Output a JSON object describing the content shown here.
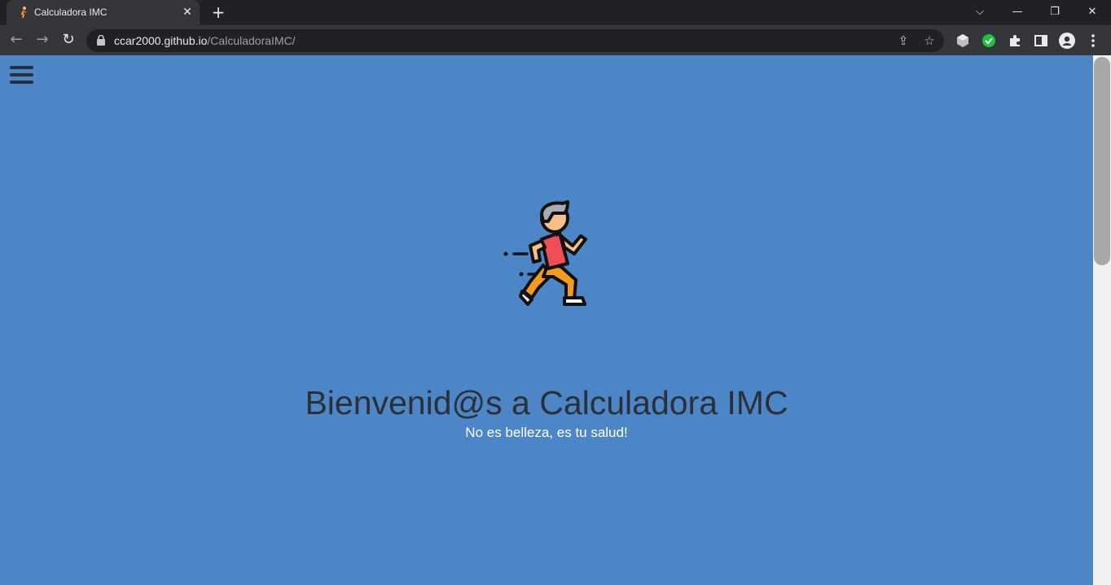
{
  "browser": {
    "tab_title": "Calculadora IMC",
    "tab_close_glyph": "✕",
    "new_tab_glyph": "+",
    "url_host": "ccar2000.github.io",
    "url_path": "/CalculadoraIMC/",
    "window_controls": {
      "tabs_menu": "⌵",
      "minimize": "—",
      "restore": "❐",
      "close": "✕"
    },
    "nav": {
      "back": "←",
      "forward": "→",
      "reload": "↻"
    },
    "omnibox_icons": {
      "share": "⇪",
      "bookmark": "☆"
    }
  },
  "page": {
    "headline": "Bienvenid@s a Calculadora IMC",
    "tagline": "No es belleza, es tu salud!",
    "background_color": "#4d86c7",
    "heading_color": "#2b2f36"
  }
}
